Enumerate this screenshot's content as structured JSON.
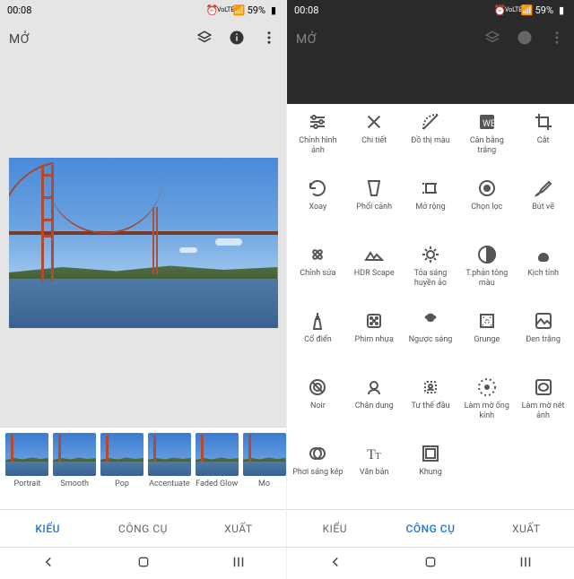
{
  "statusbar": {
    "time": "00:08",
    "battery": "59%",
    "lte": "LTE1"
  },
  "topbar": {
    "open_label": "MỞ"
  },
  "filters": [
    {
      "label": "Portrait"
    },
    {
      "label": "Smooth"
    },
    {
      "label": "Pop"
    },
    {
      "label": "Accentuate"
    },
    {
      "label": "Faded Glow"
    },
    {
      "label": "Mo"
    }
  ],
  "tabs": {
    "styles": "KIỂU",
    "tools": "CÔNG CỤ",
    "export": "XUẤT"
  },
  "tools": [
    {
      "name": "tune",
      "label": "Chỉnh hình ảnh"
    },
    {
      "name": "details",
      "label": "Chi tiết"
    },
    {
      "name": "curves",
      "label": "Đồ thị màu"
    },
    {
      "name": "white-balance",
      "label": "Cân bằng trắng"
    },
    {
      "name": "crop",
      "label": "Cắt"
    },
    {
      "name": "rotate",
      "label": "Xoay"
    },
    {
      "name": "perspective",
      "label": "Phối cảnh"
    },
    {
      "name": "expand",
      "label": "Mở rộng"
    },
    {
      "name": "selective",
      "label": "Chọn lọc"
    },
    {
      "name": "brush",
      "label": "Bút vẽ"
    },
    {
      "name": "healing",
      "label": "Chỉnh sửa"
    },
    {
      "name": "hdr-scape",
      "label": "HDR Scape"
    },
    {
      "name": "glamour-glow",
      "label": "Tỏa sáng huyền ảo"
    },
    {
      "name": "tonal-contrast",
      "label": "T.phản tông màu"
    },
    {
      "name": "drama",
      "label": "Kịch tính"
    },
    {
      "name": "vintage",
      "label": "Cổ điển"
    },
    {
      "name": "grainy-film",
      "label": "Phim nhựa"
    },
    {
      "name": "retrolux",
      "label": "Ngược sáng"
    },
    {
      "name": "grunge",
      "label": "Grunge"
    },
    {
      "name": "bw",
      "label": "Đen trắng"
    },
    {
      "name": "noir",
      "label": "Noir"
    },
    {
      "name": "portrait",
      "label": "Chân dung"
    },
    {
      "name": "head-pose",
      "label": "Tư thế đầu"
    },
    {
      "name": "lens-blur",
      "label": "Làm mờ ống kính"
    },
    {
      "name": "vignette",
      "label": "Làm mờ nét ảnh"
    },
    {
      "name": "double-exposure",
      "label": "Phơi sáng kép"
    },
    {
      "name": "text",
      "label": "Văn bản"
    },
    {
      "name": "frames",
      "label": "Khung"
    }
  ]
}
